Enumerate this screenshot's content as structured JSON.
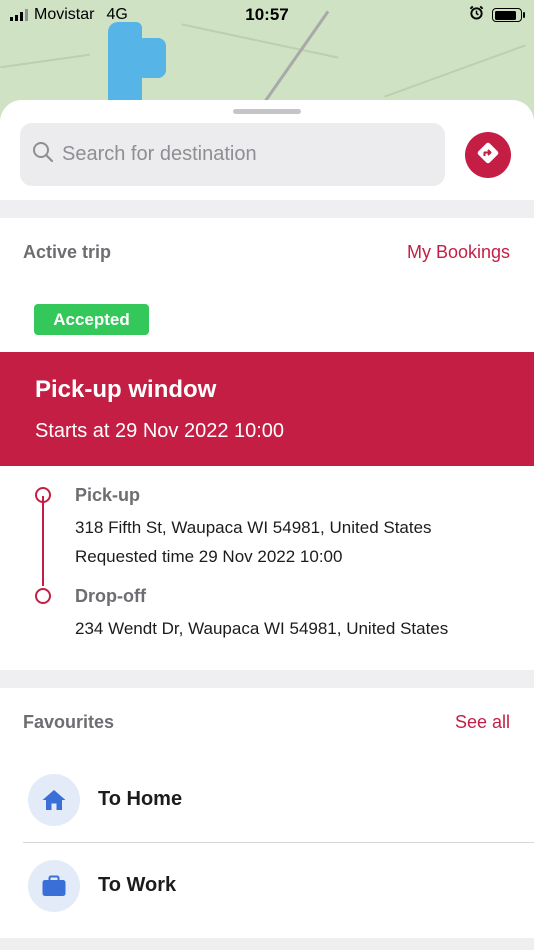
{
  "status_bar": {
    "carrier": "Movistar",
    "network": "4G",
    "time": "10:57",
    "battery_level": 0.85
  },
  "search": {
    "placeholder": "Search for destination"
  },
  "active_trip": {
    "section_title": "Active trip",
    "bookings_link": "My Bookings",
    "status_badge": "Accepted",
    "window_title": "Pick-up window",
    "window_start": "Starts at 29 Nov 2022 10:00",
    "pickup": {
      "label": "Pick-up",
      "address": "318 Fifth St, Waupaca WI 54981, United States",
      "requested": "Requested time 29 Nov 2022 10:00"
    },
    "dropoff": {
      "label": "Drop-off",
      "address": "234 Wendt Dr, Waupaca WI 54981, United States"
    }
  },
  "favourites": {
    "section_title": "Favourites",
    "see_all": "See all",
    "items": [
      {
        "label": "To Home",
        "icon": "home-icon"
      },
      {
        "label": "To Work",
        "icon": "briefcase-icon"
      }
    ]
  },
  "colors": {
    "accent": "#c41e44",
    "success": "#34c759",
    "fav_icon": "#3a6fd8"
  }
}
